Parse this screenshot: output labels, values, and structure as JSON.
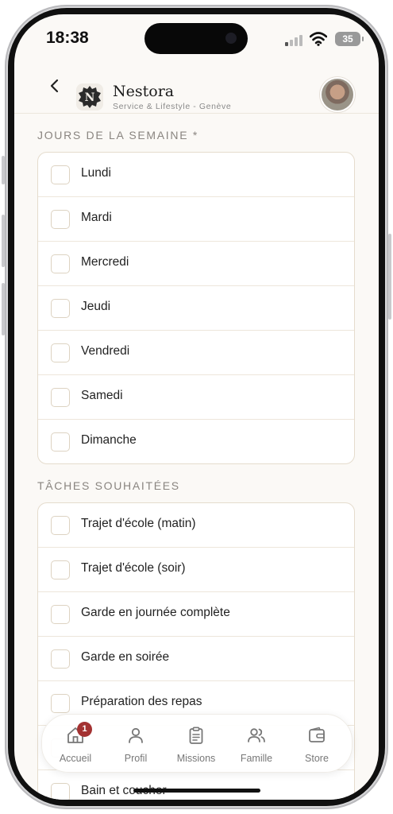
{
  "status_bar": {
    "time": "18:38",
    "battery": "35"
  },
  "header": {
    "brand": "Nestora",
    "subtitle": "Service & Lifestyle - Genève",
    "logo_letter": "N"
  },
  "days_section": {
    "title": "JOURS DE LA SEMAINE *",
    "items": [
      "Lundi",
      "Mardi",
      "Mercredi",
      "Jeudi",
      "Vendredi",
      "Samedi",
      "Dimanche"
    ]
  },
  "tasks_section": {
    "title": "TÂCHES SOUHAITÉES",
    "items": [
      "Trajet d'école (matin)",
      "Trajet d'école (soir)",
      "Garde en journée complète",
      "Garde en soirée",
      "Préparation des repas",
      "",
      "Bain et coucher"
    ]
  },
  "tabbar": {
    "items": [
      {
        "label": "Accueil",
        "icon": "home-icon",
        "badge": "1"
      },
      {
        "label": "Profil",
        "icon": "person-icon"
      },
      {
        "label": "Missions",
        "icon": "clipboard-icon"
      },
      {
        "label": "Famille",
        "icon": "people-icon"
      },
      {
        "label": "Store",
        "icon": "wallet-icon"
      }
    ]
  },
  "colors": {
    "background": "#fbf9f6",
    "border": "#e5dccd",
    "badge": "#a33131",
    "text": "#222222"
  }
}
